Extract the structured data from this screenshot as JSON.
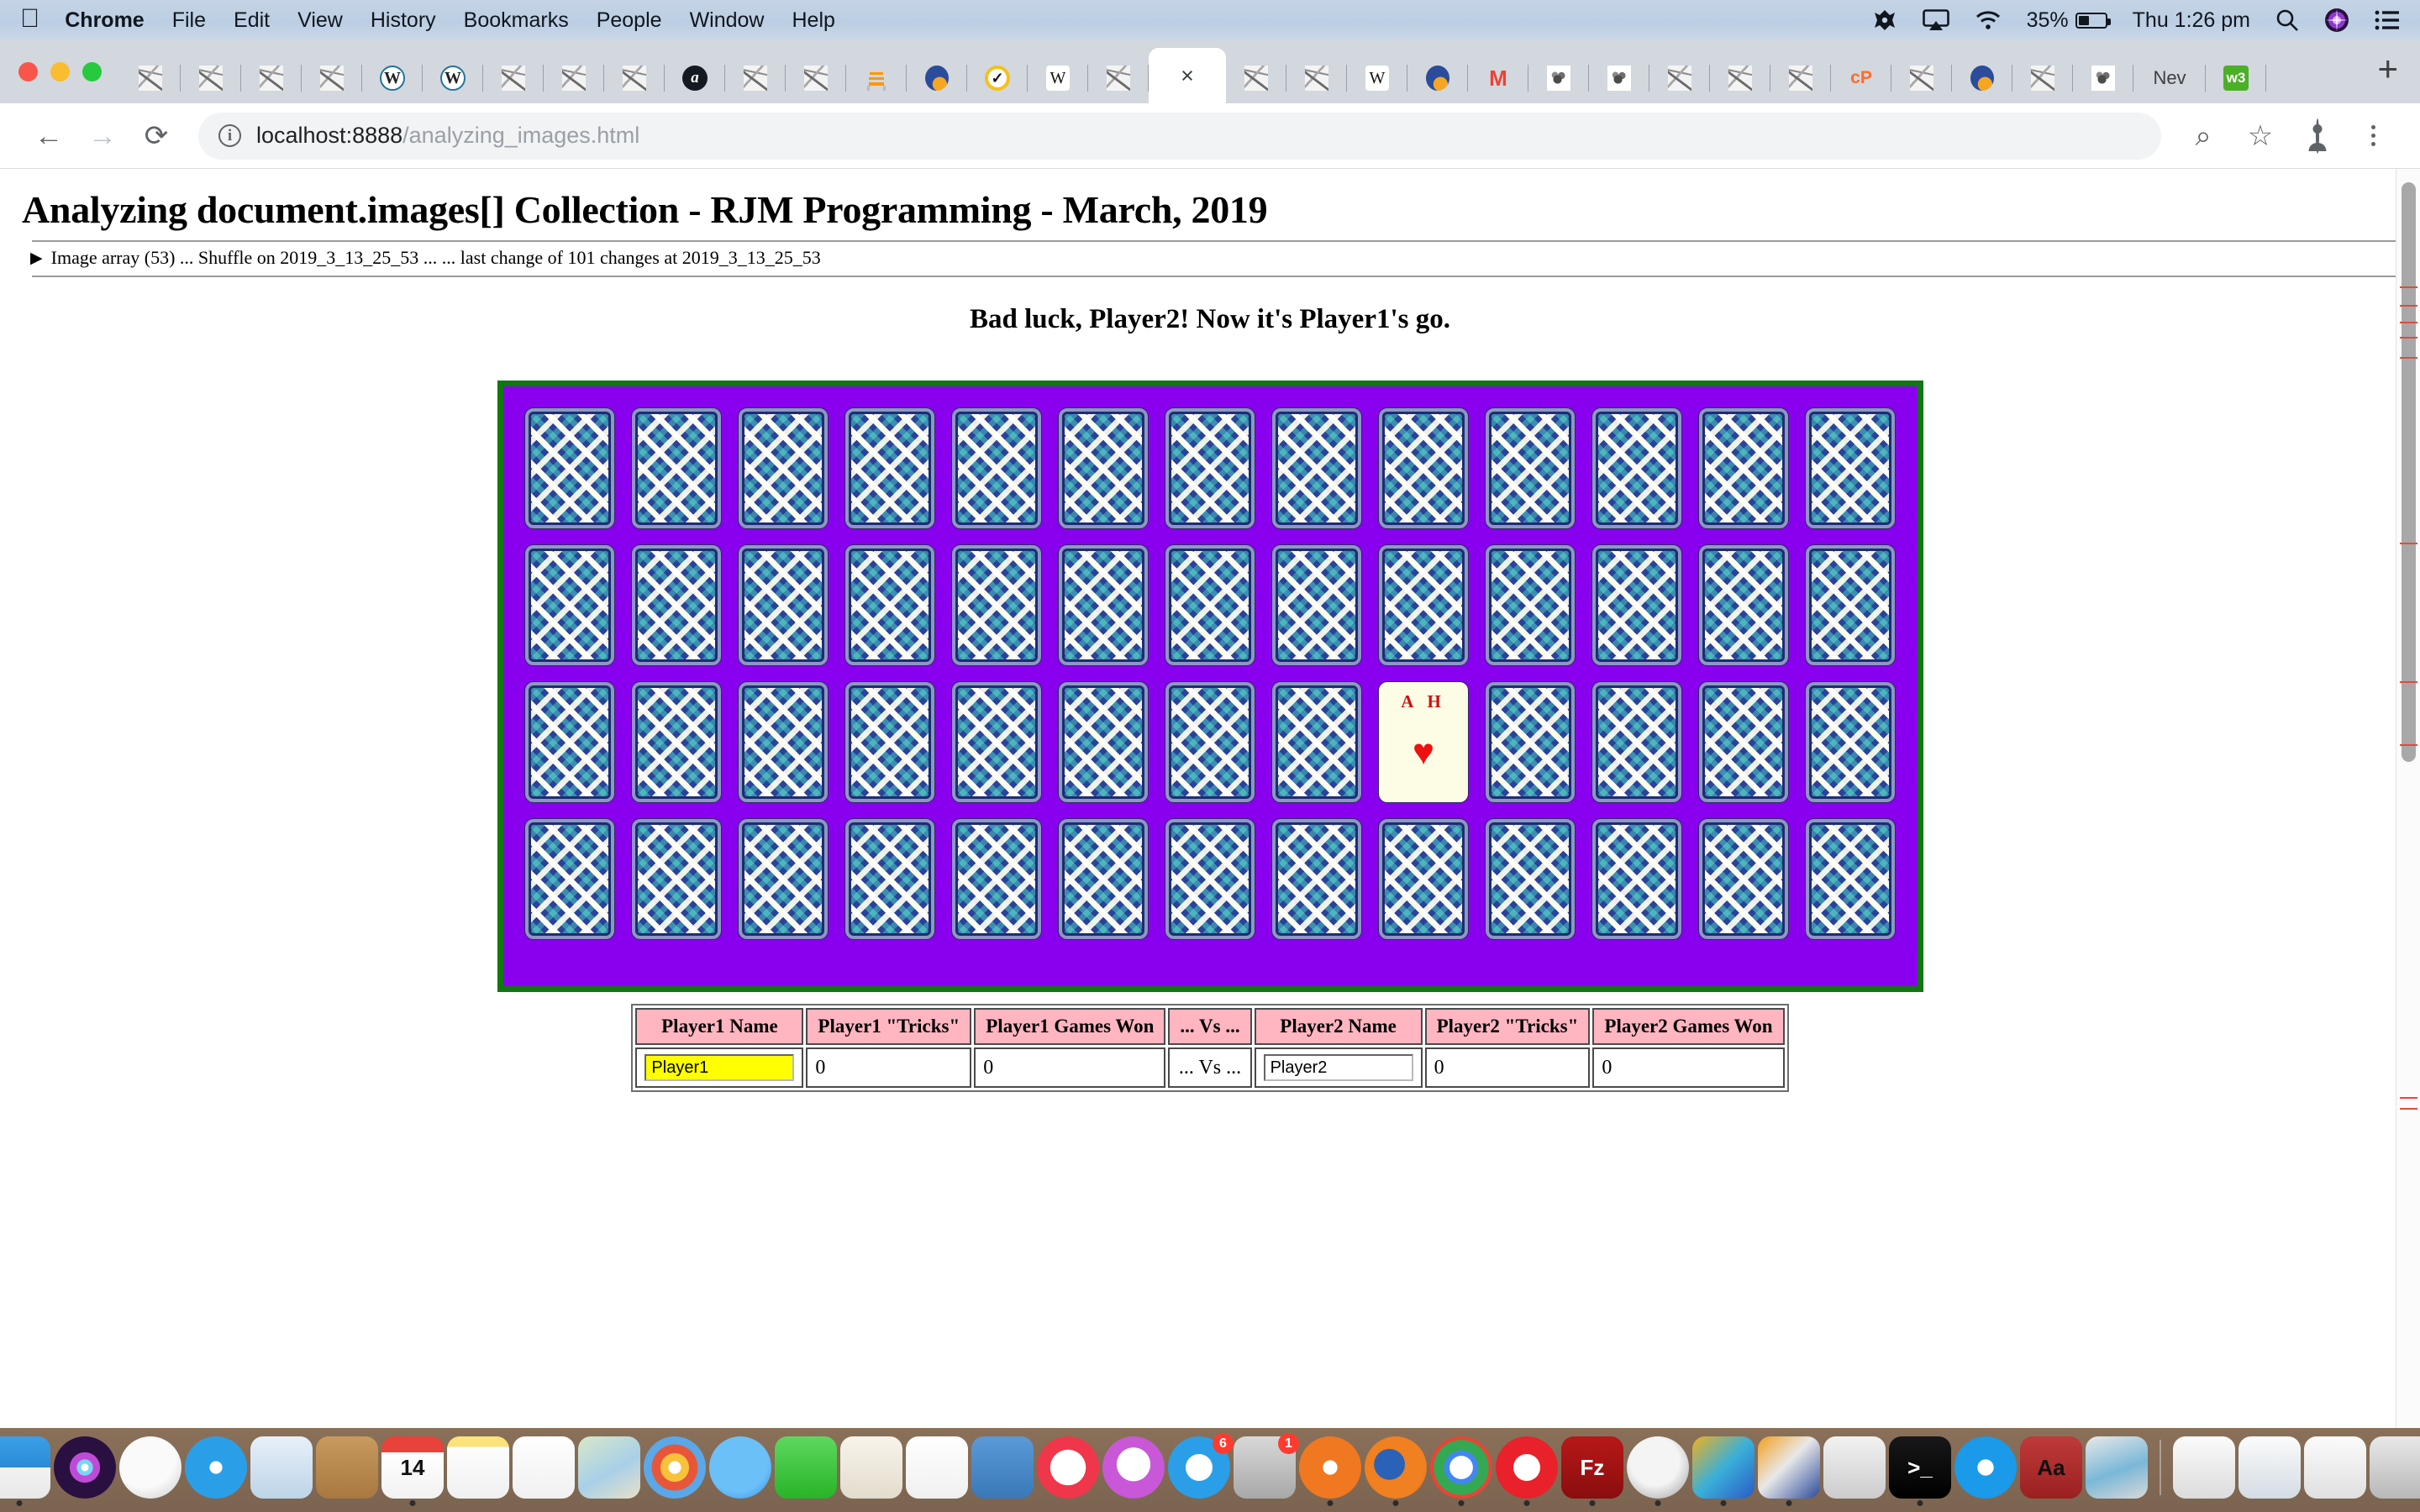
{
  "menubar": {
    "apple_glyph": "",
    "items": [
      {
        "label": "Chrome",
        "bold": true
      },
      {
        "label": "File",
        "bold": false
      },
      {
        "label": "Edit",
        "bold": false
      },
      {
        "label": "View",
        "bold": false
      },
      {
        "label": "History",
        "bold": false
      },
      {
        "label": "Bookmarks",
        "bold": false
      },
      {
        "label": "People",
        "bold": false
      },
      {
        "label": "Window",
        "bold": false
      },
      {
        "label": "Help",
        "bold": false
      }
    ],
    "status": {
      "battery_percent": "35%",
      "clock": "Thu 1:26 pm",
      "icons": [
        "dropbox-icon",
        "airplay-icon",
        "wifi-icon",
        "battery-icon",
        "spotlight-search-icon",
        "siri-icon",
        "notification-center-icon"
      ]
    }
  },
  "browser": {
    "window_controls": [
      "close",
      "minimize",
      "maximize"
    ],
    "tabs": [
      {
        "favicon": "generic",
        "active": false,
        "label": ""
      },
      {
        "favicon": "generic",
        "active": false,
        "label": ""
      },
      {
        "favicon": "generic",
        "active": false,
        "label": ""
      },
      {
        "favicon": "generic",
        "active": false,
        "label": ""
      },
      {
        "favicon": "wordpress",
        "active": false,
        "label": ""
      },
      {
        "favicon": "wordpress",
        "active": false,
        "label": ""
      },
      {
        "favicon": "generic",
        "active": false,
        "label": ""
      },
      {
        "favicon": "generic",
        "active": false,
        "label": ""
      },
      {
        "favicon": "generic",
        "active": false,
        "label": ""
      },
      {
        "favicon": "amazon",
        "active": false,
        "label": ""
      },
      {
        "favicon": "generic",
        "active": false,
        "label": ""
      },
      {
        "favicon": "generic",
        "active": false,
        "label": ""
      },
      {
        "favicon": "stackoverflow",
        "active": false,
        "label": ""
      },
      {
        "favicon": "blob",
        "active": false,
        "label": ""
      },
      {
        "favicon": "tick",
        "active": false,
        "label": ""
      },
      {
        "favicon": "wikipedia",
        "active": false,
        "label": ""
      },
      {
        "favicon": "generic",
        "active": false,
        "label": ""
      },
      {
        "favicon": "none",
        "active": true,
        "label": "",
        "close_glyph": "×"
      },
      {
        "favicon": "generic",
        "active": false,
        "label": ""
      },
      {
        "favicon": "generic",
        "active": false,
        "label": ""
      },
      {
        "favicon": "wikipedia",
        "active": false,
        "label": ""
      },
      {
        "favicon": "blob",
        "active": false,
        "label": ""
      },
      {
        "favicon": "gmail",
        "active": false,
        "label": ""
      },
      {
        "favicon": "gimp",
        "active": false,
        "label": ""
      },
      {
        "favicon": "gimp",
        "active": false,
        "label": ""
      },
      {
        "favicon": "generic",
        "active": false,
        "label": ""
      },
      {
        "favicon": "generic",
        "active": false,
        "label": ""
      },
      {
        "favicon": "generic",
        "active": false,
        "label": ""
      },
      {
        "favicon": "cpanel",
        "active": false,
        "label": ""
      },
      {
        "favicon": "generic",
        "active": false,
        "label": ""
      },
      {
        "favicon": "blob",
        "active": false,
        "label": ""
      },
      {
        "favicon": "generic",
        "active": false,
        "label": ""
      },
      {
        "favicon": "gimp",
        "active": false,
        "label": ""
      },
      {
        "favicon": "none",
        "active": false,
        "label": "Nev"
      },
      {
        "favicon": "w3schools",
        "active": false,
        "label": ""
      }
    ],
    "new_tab_glyph": "+",
    "toolbar": {
      "back_glyph": "←",
      "forward_glyph": "→",
      "reload_glyph": "⟳",
      "site_info_glyph": "i",
      "url_host": "localhost:8888",
      "url_path": "/analyzing_images.html",
      "zoom_glyph": "⌕",
      "bookmark_glyph": "☆",
      "profile_name": "avatar",
      "menu_glyph": "⋮"
    }
  },
  "page": {
    "title": "Analyzing document.images[] Collection - RJM Programming - March, 2019",
    "details_disclosure": "▶",
    "details_summary": "Image array (53) ... Shuffle on 2019_3_13_25_53 ... ... last change of 101 changes at 2019_3_13_25_53",
    "game_message": "Bad luck, Player2! Now it's Player1's go.",
    "table_colors": {
      "felt": "#8800ee",
      "felt_border": "#117711",
      "card_back_navy": "#16235f",
      "card_back_teal": "#2a7b7f",
      "card_back_cream": "#fdfce4",
      "header_pink": "#ffb6c1",
      "active_input_yellow": "#ffff00",
      "pip_red": "#ee1111"
    },
    "card_grid": {
      "rows": 4,
      "columns": 13,
      "total_cards": 52,
      "face_up": [
        {
          "row": 3,
          "column": 9,
          "rank": "A",
          "suit_letter": "H",
          "label": "A H",
          "pip": "♥",
          "color": "#ee1111"
        }
      ]
    },
    "score_table": {
      "headers": [
        "Player1 Name",
        "Player1 \"Tricks\"",
        "Player1 Games Won",
        "... Vs ...",
        "Player2 Name",
        "Player2 \"Tricks\"",
        "Player2 Games Won"
      ],
      "row": {
        "player1_name": "Player1",
        "player1_tricks": "0",
        "player1_games_won": "0",
        "vs": "... Vs ...",
        "player2_name": "Player2",
        "player2_tricks": "0",
        "player2_games_won": "0"
      }
    }
  },
  "dock": {
    "items": [
      {
        "name": "finder",
        "shape": "sq",
        "bg": "linear-gradient(180deg,#3aa0e8 0%,#2b8bd6 50%,#f2f2f2 50%,#e8e8e8 100%)",
        "running": true
      },
      {
        "name": "siri",
        "shape": "cir",
        "bg": "radial-gradient(circle at 50% 50%, #ffffff 0 8%, #7bd5f5 9% 18%, #c04ad8 19% 34%, #2a1040 35% 100%)",
        "running": false
      },
      {
        "name": "launchpad",
        "shape": "cir",
        "bg": "radial-gradient(circle at 40% 32%, #fafafa 0 55%, #c9c9c9 100%)",
        "running": false
      },
      {
        "name": "safari",
        "shape": "cir",
        "bg": "radial-gradient(circle at 50% 50%, #ffffff 0 14%, #2a9fe8 15% 88%, #d8e8f2 100%)",
        "running": false
      },
      {
        "name": "mail",
        "shape": "sq",
        "bg": "linear-gradient(180deg,#e8f0f8 0%,#bdd4e8 100%)",
        "running": false
      },
      {
        "name": "contacts",
        "shape": "sq",
        "bg": "linear-gradient(180deg,#c89a5e 0%,#a87840 100%)",
        "running": false
      },
      {
        "name": "calendar",
        "shape": "sq",
        "bg": "linear-gradient(180deg,#e8423a 0%,#e8423a 26%,#ffffff 26%,#f2f2f2 100%)",
        "running": true,
        "text": "14"
      },
      {
        "name": "notes",
        "shape": "sq",
        "bg": "linear-gradient(180deg,#fbe27a 0%,#fbe27a 17%,#fdfdfd 17%,#f0f0f0 100%)",
        "running": false
      },
      {
        "name": "reminders",
        "shape": "sq",
        "bg": "linear-gradient(180deg,#ffffff 0%,#f0f0f0 100%)",
        "running": false
      },
      {
        "name": "maps",
        "shape": "sq",
        "bg": "linear-gradient(150deg,#d8e8c8 0%,#a8d0e8 55%,#e8e0c8 100%)",
        "running": false
      },
      {
        "name": "photos",
        "shape": "cir",
        "bg": "radial-gradient(circle at 50% 50%, #ffffff 0 14%, #f8c23a 15% 32%, #e8563a 33% 52%, #5aa8e8 53% 72%, #7ac83a 73% 100%)",
        "running": false
      },
      {
        "name": "messages",
        "shape": "cir",
        "bg": "radial-gradient(circle at 45% 40%, #6cc0f8 0 60%, #2a8ae8 100%)",
        "running": false
      },
      {
        "name": "facetime",
        "shape": "sq",
        "bg": "linear-gradient(180deg,#5ed85e 0%,#28b428 100%)",
        "running": false
      },
      {
        "name": "pages",
        "shape": "sq",
        "bg": "linear-gradient(180deg,#f8f4ec 0%,#e2dccc 100%)",
        "running": false
      },
      {
        "name": "numbers",
        "shape": "sq",
        "bg": "linear-gradient(180deg,#ffffff 0%,#f0f0f0 100%)",
        "running": false
      },
      {
        "name": "keynote",
        "shape": "sq",
        "bg": "linear-gradient(180deg,#5a9ad8 0%,#3a78b8 100%)",
        "running": false
      },
      {
        "name": "news",
        "shape": "cir",
        "bg": "radial-gradient(circle at 50% 50%, #ffffff 0 40%, #f0364a 41% 100%)",
        "running": false
      },
      {
        "name": "itunes",
        "shape": "cir",
        "bg": "radial-gradient(circle at 50% 45%, #ffffff 0 36%, #c858d8 37% 70%, #8a3ad0 100%)",
        "running": false
      },
      {
        "name": "app-store",
        "shape": "cir",
        "bg": "radial-gradient(circle at 50% 50%, #ffffff 0 30%, #2a9fe8 31% 100%)",
        "running": false,
        "badge": "6"
      },
      {
        "name": "system-preferences",
        "shape": "sq",
        "bg": "linear-gradient(180deg,#d8d8d8 0%,#a8a8a8 100%)",
        "running": false,
        "badge": "1"
      },
      {
        "name": "audacity",
        "shape": "cir",
        "bg": "radial-gradient(circle at 50% 50%, #ffffff 0 16%, #f07820 17% 100%)",
        "running": true
      },
      {
        "name": "firefox",
        "shape": "cir",
        "bg": "radial-gradient(circle at 40% 45%, #2a62b8 0 30%, #f08020 31% 70%, #e04a10 100%)",
        "running": true
      },
      {
        "name": "chrome",
        "shape": "cir",
        "bg": "radial-gradient(circle at 50% 50%, #ffffff 0 26%, #4285f4 27% 38%, #34a853 39% 62%, #ea4335 63% 82%, #fbbc05 83% 100%)",
        "running": true
      },
      {
        "name": "opera",
        "shape": "cir",
        "bg": "radial-gradient(circle at 50% 50%, #ffffff 0 30%, #e8212a 31% 100%)",
        "running": true
      },
      {
        "name": "filezilla",
        "shape": "sq",
        "bg": "linear-gradient(180deg,#b81818 0%,#8a0d0d 100%)",
        "running": true,
        "text": "Fz"
      },
      {
        "name": "mamp",
        "shape": "cir",
        "bg": "radial-gradient(circle at 45% 40%, #f4f4f4 0 48%, #9a9a9a 100%)",
        "running": true
      },
      {
        "name": "dreamweaver",
        "shape": "sq",
        "bg": "linear-gradient(135deg,#f0b020 0%,#3ab0d8 50%,#2a5ac8 100%)",
        "running": true
      },
      {
        "name": "nitro",
        "shape": "sq",
        "bg": "linear-gradient(135deg,#f0a020 0%,#e8e8e8 45%,#2a4a9a 100%)",
        "running": true
      },
      {
        "name": "gimp",
        "shape": "sq",
        "bg": "linear-gradient(180deg,#f2f2f2 0%,#cccccc 100%)",
        "running": false
      },
      {
        "name": "terminal",
        "shape": "sq",
        "bg": "linear-gradient(180deg,#18181a 0%,#000000 100%)",
        "running": true,
        "text": ">_"
      },
      {
        "name": "quicktime",
        "shape": "cir",
        "bg": "radial-gradient(circle at 50% 50%, #ffffff 0 18%, #1a9ae8 19% 74%, #0a3a6a 100%)",
        "running": false
      },
      {
        "name": "dictionary",
        "shape": "sq",
        "bg": "linear-gradient(180deg,#c03a3a 0%,#9a2020 100%)",
        "running": false,
        "text": "Aa"
      },
      {
        "name": "preview",
        "shape": "sq",
        "bg": "linear-gradient(160deg,#e8e8e8 0%,#7ab8d8 55%,#d8d8d8 100%)",
        "running": false
      },
      {
        "name": "minimized-window-1",
        "shape": "sq",
        "bg": "linear-gradient(180deg,#fbfbfb 0%,#dcdcdc 100%)",
        "running": false
      },
      {
        "name": "minimized-window-2",
        "shape": "sq",
        "bg": "linear-gradient(180deg,#fbfbfb 0%,#d4dce4 100%)",
        "running": false
      },
      {
        "name": "minimized-window-3",
        "shape": "sq",
        "bg": "linear-gradient(180deg,#fbfbfb 0%,#e0e0e0 100%)",
        "running": false
      },
      {
        "name": "trash",
        "shape": "sq",
        "bg": "linear-gradient(180deg,#e8e8e8 0%,#b8b8b8 100%)",
        "running": false
      }
    ],
    "divider_after_index": 32
  }
}
